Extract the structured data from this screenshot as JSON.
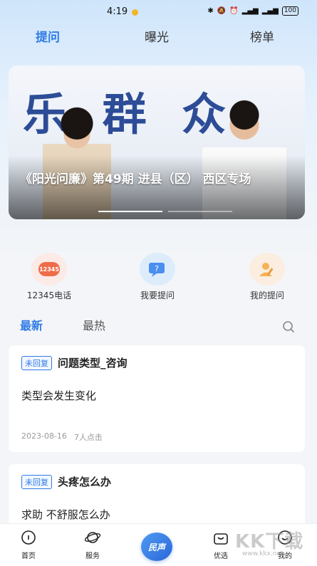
{
  "status_bar": {
    "time": "4:19",
    "battery": "100"
  },
  "top_tabs": [
    {
      "label": "提问",
      "active": true
    },
    {
      "label": "曝光",
      "active": false
    },
    {
      "label": "榜单",
      "active": false
    }
  ],
  "banner": {
    "background_text": "乐 群 众",
    "caption": "《阳光问廉》第49期 进县（区） 西区专场",
    "slide_count": 2,
    "active_slide": 1
  },
  "quick_actions": [
    {
      "label": "12345电话",
      "icon": "phone-12345-icon",
      "badge": "12345"
    },
    {
      "label": "我要提问",
      "icon": "ask-question-icon"
    },
    {
      "label": "我的提问",
      "icon": "my-questions-icon"
    }
  ],
  "feed_tabs": [
    {
      "label": "最新",
      "active": true
    },
    {
      "label": "最热",
      "active": false
    }
  ],
  "posts": [
    {
      "status": "未回复",
      "title": "问题类型_咨询",
      "body": "类型会发生变化",
      "date": "2023-08-16",
      "clicks": "7人点击"
    },
    {
      "status": "未回复",
      "title": "头疼怎么办",
      "body": "求助 不舒服怎么办"
    }
  ],
  "bottom_nav": {
    "home": "首页",
    "service": "服务",
    "center": "民声",
    "picks": "优选",
    "mine": "我的"
  },
  "watermark": {
    "text": "KK下载",
    "url": "www.kkx.net"
  },
  "colors": {
    "accent": "#2f7be6",
    "tag_border": "#2f7be6",
    "hat": "#f7b733"
  }
}
